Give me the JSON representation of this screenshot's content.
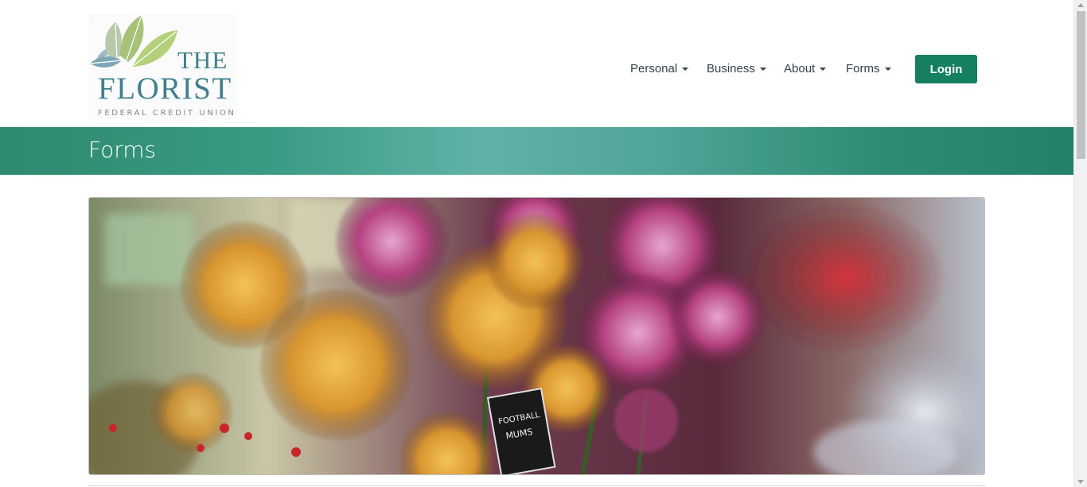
{
  "logo": {
    "line1": "THE",
    "line2": "FLORIST",
    "line3": "FEDERAL CREDIT UNION"
  },
  "nav": {
    "items": [
      {
        "label": "Personal"
      },
      {
        "label": "Business"
      },
      {
        "label": "About"
      },
      {
        "label": "Forms"
      }
    ],
    "login_label": "Login"
  },
  "banner": {
    "title": "Forms"
  },
  "hero": {
    "sign_line1": "FOOTBALL",
    "sign_line2": "MUMS"
  },
  "colors": {
    "brand_green": "#14805f",
    "banner_teal": "#3a9a84",
    "logo_teal": "#3f7f8f"
  }
}
